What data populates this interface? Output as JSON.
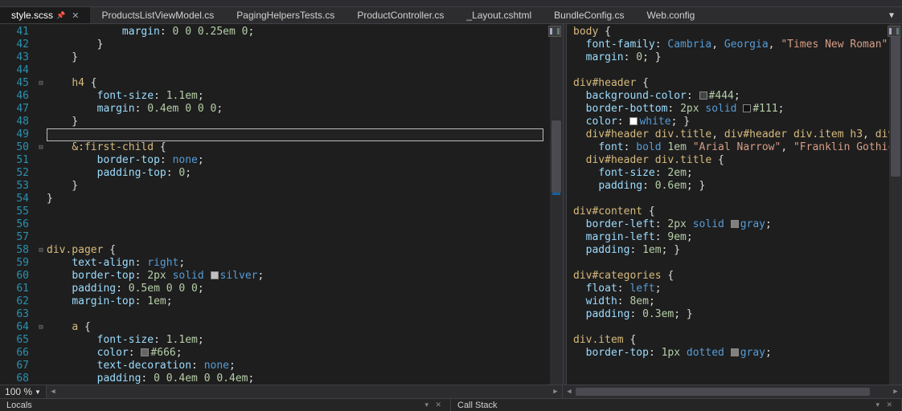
{
  "tabs": [
    {
      "label": "style.scss",
      "active": true,
      "pinned": true
    },
    {
      "label": "ProductsListViewModel.cs"
    },
    {
      "label": "PagingHelpersTests.cs"
    },
    {
      "label": "ProductController.cs"
    },
    {
      "label": "_Layout.cshtml"
    },
    {
      "label": "BundleConfig.cs"
    },
    {
      "label": "Web.config"
    }
  ],
  "zoom": "100 %",
  "bottom_panels": [
    "Locals",
    "Call Stack"
  ],
  "left_start_line": 41,
  "left_cursor_line": 49,
  "left_lines": [
    {
      "n": 41,
      "f": "",
      "t": [
        [
          "            ",
          ""
        ],
        [
          "margin",
          "prop"
        ],
        [
          ": ",
          "punc"
        ],
        [
          "0 0 0.25em 0",
          "num"
        ],
        [
          ";",
          "punc"
        ]
      ]
    },
    {
      "n": 42,
      "f": "",
      "t": [
        [
          "        }",
          "punc"
        ]
      ]
    },
    {
      "n": 43,
      "f": "",
      "t": [
        [
          "    }",
          "punc"
        ]
      ]
    },
    {
      "n": 44,
      "f": "",
      "t": [
        [
          "",
          ""
        ]
      ]
    },
    {
      "n": 45,
      "f": "⊟",
      "t": [
        [
          "    ",
          ""
        ],
        [
          "h4",
          "sel"
        ],
        [
          " {",
          "punc"
        ]
      ]
    },
    {
      "n": 46,
      "f": "",
      "t": [
        [
          "        ",
          ""
        ],
        [
          "font-size",
          "prop"
        ],
        [
          ": ",
          "punc"
        ],
        [
          "1.1em",
          "num"
        ],
        [
          ";",
          "punc"
        ]
      ]
    },
    {
      "n": 47,
      "f": "",
      "t": [
        [
          "        ",
          ""
        ],
        [
          "margin",
          "prop"
        ],
        [
          ": ",
          "punc"
        ],
        [
          "0.4em 0 0 0",
          "num"
        ],
        [
          ";",
          "punc"
        ]
      ]
    },
    {
      "n": 48,
      "f": "",
      "t": [
        [
          "    }",
          "punc"
        ]
      ]
    },
    {
      "n": 49,
      "f": "",
      "t": [
        [
          "",
          ""
        ]
      ]
    },
    {
      "n": 50,
      "f": "⊟",
      "t": [
        [
          "    ",
          ""
        ],
        [
          "&:first-child",
          "sel"
        ],
        [
          " {",
          "punc"
        ]
      ]
    },
    {
      "n": 51,
      "f": "",
      "t": [
        [
          "        ",
          ""
        ],
        [
          "border-top",
          "prop"
        ],
        [
          ": ",
          "punc"
        ],
        [
          "none",
          "kw"
        ],
        [
          ";",
          "punc"
        ]
      ]
    },
    {
      "n": 52,
      "f": "",
      "t": [
        [
          "        ",
          ""
        ],
        [
          "padding-top",
          "prop"
        ],
        [
          ": ",
          "punc"
        ],
        [
          "0",
          "num"
        ],
        [
          ";",
          "punc"
        ]
      ]
    },
    {
      "n": 53,
      "f": "",
      "t": [
        [
          "    }",
          "punc"
        ]
      ]
    },
    {
      "n": 54,
      "f": "",
      "t": [
        [
          "}",
          "punc"
        ]
      ]
    },
    {
      "n": 55,
      "f": "",
      "t": [
        [
          "",
          ""
        ]
      ]
    },
    {
      "n": 56,
      "f": "",
      "t": [
        [
          "",
          ""
        ]
      ]
    },
    {
      "n": 57,
      "f": "",
      "t": [
        [
          "",
          ""
        ]
      ]
    },
    {
      "n": 58,
      "f": "⊟",
      "t": [
        [
          "div.pager",
          "sel"
        ],
        [
          " {",
          "punc"
        ]
      ]
    },
    {
      "n": 59,
      "f": "",
      "t": [
        [
          "    ",
          ""
        ],
        [
          "text-align",
          "prop"
        ],
        [
          ": ",
          "punc"
        ],
        [
          "right",
          "kw"
        ],
        [
          ";",
          "punc"
        ]
      ]
    },
    {
      "n": 60,
      "f": "",
      "t": [
        [
          "    ",
          ""
        ],
        [
          "border-top",
          "prop"
        ],
        [
          ": ",
          "punc"
        ],
        [
          "2px",
          "num"
        ],
        [
          " ",
          "punc"
        ],
        [
          "solid",
          "kw"
        ],
        [
          " ",
          "punc"
        ],
        [
          "#c0c0c0",
          "swatch"
        ],
        [
          "silver",
          "kw"
        ],
        [
          ";",
          "punc"
        ]
      ]
    },
    {
      "n": 61,
      "f": "",
      "t": [
        [
          "    ",
          ""
        ],
        [
          "padding",
          "prop"
        ],
        [
          ": ",
          "punc"
        ],
        [
          "0.5em 0 0 0",
          "num"
        ],
        [
          ";",
          "punc"
        ]
      ]
    },
    {
      "n": 62,
      "f": "",
      "t": [
        [
          "    ",
          ""
        ],
        [
          "margin-top",
          "prop"
        ],
        [
          ": ",
          "punc"
        ],
        [
          "1em",
          "num"
        ],
        [
          ";",
          "punc"
        ]
      ]
    },
    {
      "n": 63,
      "f": "",
      "t": [
        [
          "",
          ""
        ]
      ]
    },
    {
      "n": 64,
      "f": "⊟",
      "t": [
        [
          "    ",
          ""
        ],
        [
          "a",
          "sel"
        ],
        [
          " {",
          "punc"
        ]
      ]
    },
    {
      "n": 65,
      "f": "",
      "t": [
        [
          "        ",
          ""
        ],
        [
          "font-size",
          "prop"
        ],
        [
          ": ",
          "punc"
        ],
        [
          "1.1em",
          "num"
        ],
        [
          ";",
          "punc"
        ]
      ]
    },
    {
      "n": 66,
      "f": "",
      "t": [
        [
          "        ",
          ""
        ],
        [
          "color",
          "prop"
        ],
        [
          ": ",
          "punc"
        ],
        [
          "#666666",
          "swatch"
        ],
        [
          "#666",
          "num"
        ],
        [
          ";",
          "punc"
        ]
      ]
    },
    {
      "n": 67,
      "f": "",
      "t": [
        [
          "        ",
          ""
        ],
        [
          "text-decoration",
          "prop"
        ],
        [
          ": ",
          "punc"
        ],
        [
          "none",
          "kw"
        ],
        [
          ";",
          "punc"
        ]
      ]
    },
    {
      "n": 68,
      "f": "",
      "t": [
        [
          "        ",
          ""
        ],
        [
          "padding",
          "prop"
        ],
        [
          ": ",
          "punc"
        ],
        [
          "0 0.4em 0 0.4em",
          "num"
        ],
        [
          ";",
          "punc"
        ]
      ]
    }
  ],
  "right_lines": [
    {
      "t": [
        [
          "body",
          "sel"
        ],
        [
          " {",
          "punc"
        ]
      ]
    },
    {
      "t": [
        [
          "  ",
          ""
        ],
        [
          "font-family",
          "prop"
        ],
        [
          ": ",
          "punc"
        ],
        [
          "Cambria",
          "kw"
        ],
        [
          ", ",
          "punc"
        ],
        [
          "Georgia",
          "kw"
        ],
        [
          ", ",
          "punc"
        ],
        [
          "\"Times New Roman\"",
          "str"
        ],
        [
          ";",
          "punc"
        ]
      ]
    },
    {
      "t": [
        [
          "  ",
          ""
        ],
        [
          "margin",
          "prop"
        ],
        [
          ": ",
          "punc"
        ],
        [
          "0",
          "num"
        ],
        [
          "; }",
          "punc"
        ]
      ]
    },
    {
      "t": [
        [
          "",
          ""
        ]
      ]
    },
    {
      "t": [
        [
          "div#header",
          "sel"
        ],
        [
          " {",
          "punc"
        ]
      ]
    },
    {
      "t": [
        [
          "  ",
          ""
        ],
        [
          "background-color",
          "prop"
        ],
        [
          ": ",
          "punc"
        ],
        [
          "#444444",
          "swatch"
        ],
        [
          "#444",
          "num"
        ],
        [
          ";",
          "punc"
        ]
      ]
    },
    {
      "t": [
        [
          "  ",
          ""
        ],
        [
          "border-bottom",
          "prop"
        ],
        [
          ": ",
          "punc"
        ],
        [
          "2px",
          "num"
        ],
        [
          " ",
          "punc"
        ],
        [
          "solid",
          "kw"
        ],
        [
          " ",
          "punc"
        ],
        [
          "#111111",
          "swatch"
        ],
        [
          "#111",
          "num"
        ],
        [
          ";",
          "punc"
        ]
      ]
    },
    {
      "t": [
        [
          "  ",
          ""
        ],
        [
          "color",
          "prop"
        ],
        [
          ": ",
          "punc"
        ],
        [
          "#ffffff",
          "swatch"
        ],
        [
          "white",
          "kw"
        ],
        [
          "; }",
          "punc"
        ]
      ]
    },
    {
      "t": [
        [
          "  ",
          ""
        ],
        [
          "div#header div.title",
          "sel"
        ],
        [
          ", ",
          "punc"
        ],
        [
          "div#header div.item h3",
          "sel"
        ],
        [
          ", ",
          "punc"
        ],
        [
          "div#h",
          "sel"
        ]
      ]
    },
    {
      "t": [
        [
          "    ",
          ""
        ],
        [
          "font",
          "prop"
        ],
        [
          ": ",
          "punc"
        ],
        [
          "bold",
          "kw"
        ],
        [
          " ",
          "punc"
        ],
        [
          "1em",
          "num"
        ],
        [
          " ",
          "punc"
        ],
        [
          "\"Arial Narrow\"",
          "str"
        ],
        [
          ", ",
          "punc"
        ],
        [
          "\"Franklin Gothic\"",
          "str"
        ],
        [
          ",",
          "punc"
        ]
      ]
    },
    {
      "t": [
        [
          "  ",
          ""
        ],
        [
          "div#header div.title",
          "sel"
        ],
        [
          " {",
          "punc"
        ]
      ]
    },
    {
      "t": [
        [
          "    ",
          ""
        ],
        [
          "font-size",
          "prop"
        ],
        [
          ": ",
          "punc"
        ],
        [
          "2em",
          "num"
        ],
        [
          ";",
          "punc"
        ]
      ]
    },
    {
      "t": [
        [
          "    ",
          ""
        ],
        [
          "padding",
          "prop"
        ],
        [
          ": ",
          "punc"
        ],
        [
          "0.6em",
          "num"
        ],
        [
          "; }",
          "punc"
        ]
      ]
    },
    {
      "t": [
        [
          "",
          ""
        ]
      ]
    },
    {
      "t": [
        [
          "div#content",
          "sel"
        ],
        [
          " {",
          "punc"
        ]
      ]
    },
    {
      "t": [
        [
          "  ",
          ""
        ],
        [
          "border-left",
          "prop"
        ],
        [
          ": ",
          "punc"
        ],
        [
          "2px",
          "num"
        ],
        [
          " ",
          "punc"
        ],
        [
          "solid",
          "kw"
        ],
        [
          " ",
          "punc"
        ],
        [
          "#808080",
          "swatch"
        ],
        [
          "gray",
          "kw"
        ],
        [
          ";",
          "punc"
        ]
      ]
    },
    {
      "t": [
        [
          "  ",
          ""
        ],
        [
          "margin-left",
          "prop"
        ],
        [
          ": ",
          "punc"
        ],
        [
          "9em",
          "num"
        ],
        [
          ";",
          "punc"
        ]
      ]
    },
    {
      "t": [
        [
          "  ",
          ""
        ],
        [
          "padding",
          "prop"
        ],
        [
          ": ",
          "punc"
        ],
        [
          "1em",
          "num"
        ],
        [
          "; }",
          "punc"
        ]
      ]
    },
    {
      "t": [
        [
          "",
          ""
        ]
      ]
    },
    {
      "t": [
        [
          "div#categories",
          "sel"
        ],
        [
          " {",
          "punc"
        ]
      ]
    },
    {
      "t": [
        [
          "  ",
          ""
        ],
        [
          "float",
          "prop"
        ],
        [
          ": ",
          "punc"
        ],
        [
          "left",
          "kw"
        ],
        [
          ";",
          "punc"
        ]
      ]
    },
    {
      "t": [
        [
          "  ",
          ""
        ],
        [
          "width",
          "prop"
        ],
        [
          ": ",
          "punc"
        ],
        [
          "8em",
          "num"
        ],
        [
          ";",
          "punc"
        ]
      ]
    },
    {
      "t": [
        [
          "  ",
          ""
        ],
        [
          "padding",
          "prop"
        ],
        [
          ": ",
          "punc"
        ],
        [
          "0.3em",
          "num"
        ],
        [
          "; }",
          "punc"
        ]
      ]
    },
    {
      "t": [
        [
          "",
          ""
        ]
      ]
    },
    {
      "t": [
        [
          "div.item",
          "sel"
        ],
        [
          " {",
          "punc"
        ]
      ]
    },
    {
      "t": [
        [
          "  ",
          ""
        ],
        [
          "border-top",
          "prop"
        ],
        [
          ": ",
          "punc"
        ],
        [
          "1px",
          "num"
        ],
        [
          " ",
          "punc"
        ],
        [
          "dotted",
          "kw"
        ],
        [
          " ",
          "punc"
        ],
        [
          "#808080",
          "swatch"
        ],
        [
          "gray",
          "kw"
        ],
        [
          ";",
          "punc"
        ]
      ]
    }
  ]
}
